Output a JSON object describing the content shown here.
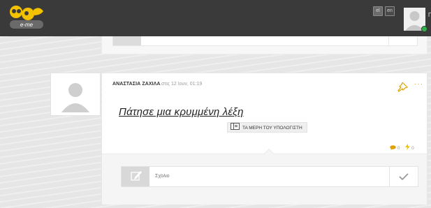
{
  "header": {
    "languages": [
      {
        "code": "el",
        "label": "el",
        "active": true
      },
      {
        "code": "en",
        "label": "en",
        "active": false
      }
    ],
    "user_initial": "Γ"
  },
  "post": {
    "author": "ΑΝΑΣΤΑΣΙΑ ΖΑΧΙΛΑ",
    "timestamp": "στις 12 Ιουν, 01:19",
    "title": "Πάτησε μια κρυμμένη λέξη",
    "category": "ΤΑ ΜΕΡΗ ΤΟΥ ΥΠΟΛΟΓΙΣΤΗ",
    "comments_count": "0",
    "likes_count": "0"
  },
  "comment": {
    "placeholder": "Σχόλιο"
  },
  "colors": {
    "topbar": "#3a3a3a",
    "accent": "#e0a000",
    "status_online": "#2fb14a"
  }
}
